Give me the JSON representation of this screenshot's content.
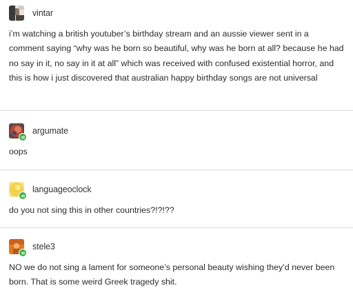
{
  "posts": [
    {
      "username": "vintar",
      "avatar": "face-photo-avatar",
      "text": "i’m watching a british youtuber’s birthday stream and an aussie viewer sent in a comment saying “why was he born so beautiful, why was he born at all? because he had no say in it, no say in it at all” which was received with confused existential horror, and this is how i just discovered that australian happy birthday songs are not universal"
    },
    {
      "username": "argumate",
      "avatar": "red-abstract-avatar",
      "badge": "reblog-icon",
      "text": "oops"
    },
    {
      "username": "languageoclock",
      "avatar": "yellow-circle-avatar",
      "badge": "reblog-icon",
      "text": "do you not sing this in other countries?!?!??"
    },
    {
      "username": "stele3",
      "avatar": "orange-figure-avatar",
      "badge": "reblog-icon",
      "text": "NO we do not sing a lament for someone’s personal beauty wishing they’d never been born. That is some weird Greek tragedy shit."
    }
  ],
  "colors": {
    "badge": "#39b54a",
    "divider": "#dcdcdc",
    "text": "#2b2b2b"
  }
}
